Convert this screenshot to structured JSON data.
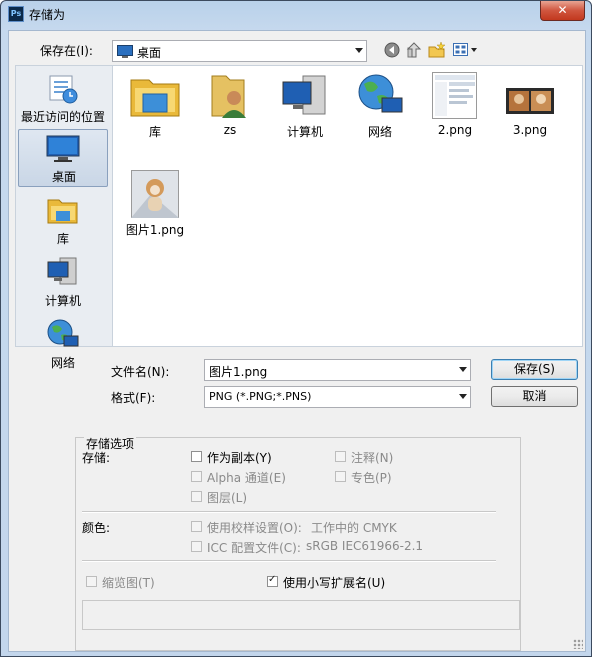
{
  "window": {
    "title": "存储为",
    "app_icon": "Ps",
    "close_glyph": "✕"
  },
  "save_in": {
    "label": "保存在(I):",
    "location": "桌面"
  },
  "places": [
    {
      "label": "最近访问的位置",
      "icon": "recent-places-icon"
    },
    {
      "label": "桌面",
      "icon": "desktop-icon",
      "selected": true
    },
    {
      "label": "库",
      "icon": "library-icon"
    },
    {
      "label": "计算机",
      "icon": "computer-icon"
    },
    {
      "label": "网络",
      "icon": "network-icon"
    }
  ],
  "files": [
    {
      "label": "库"
    },
    {
      "label": "zs"
    },
    {
      "label": "计算机"
    },
    {
      "label": "网络"
    },
    {
      "label": "2.png"
    },
    {
      "label": "3.png"
    },
    {
      "label": "图片1.png"
    }
  ],
  "filename": {
    "label": "文件名(N):",
    "value": "图片1.png"
  },
  "format": {
    "label": "格式(F):",
    "value": "PNG (*.PNG;*.PNS)"
  },
  "buttons": {
    "save": "保存(S)",
    "cancel": "取消"
  },
  "options": {
    "title": "存储选项",
    "save_label": "存储:",
    "as_copy": "作为副本(Y)",
    "notes": "注释(N)",
    "alpha": "Alpha 通道(E)",
    "spot": "专色(P)",
    "layers": "图层(L)",
    "color_label": "颜色:",
    "use_proof": "使用校样设置(O):",
    "proof_value": "工作中的 CMYK",
    "icc": "ICC 配置文件(C):",
    "icc_value": "sRGB IEC61966-2.1",
    "thumbnail": "缩览图(T)",
    "lowercase_ext": "使用小写扩展名(U)",
    "lowercase_checked": true
  }
}
